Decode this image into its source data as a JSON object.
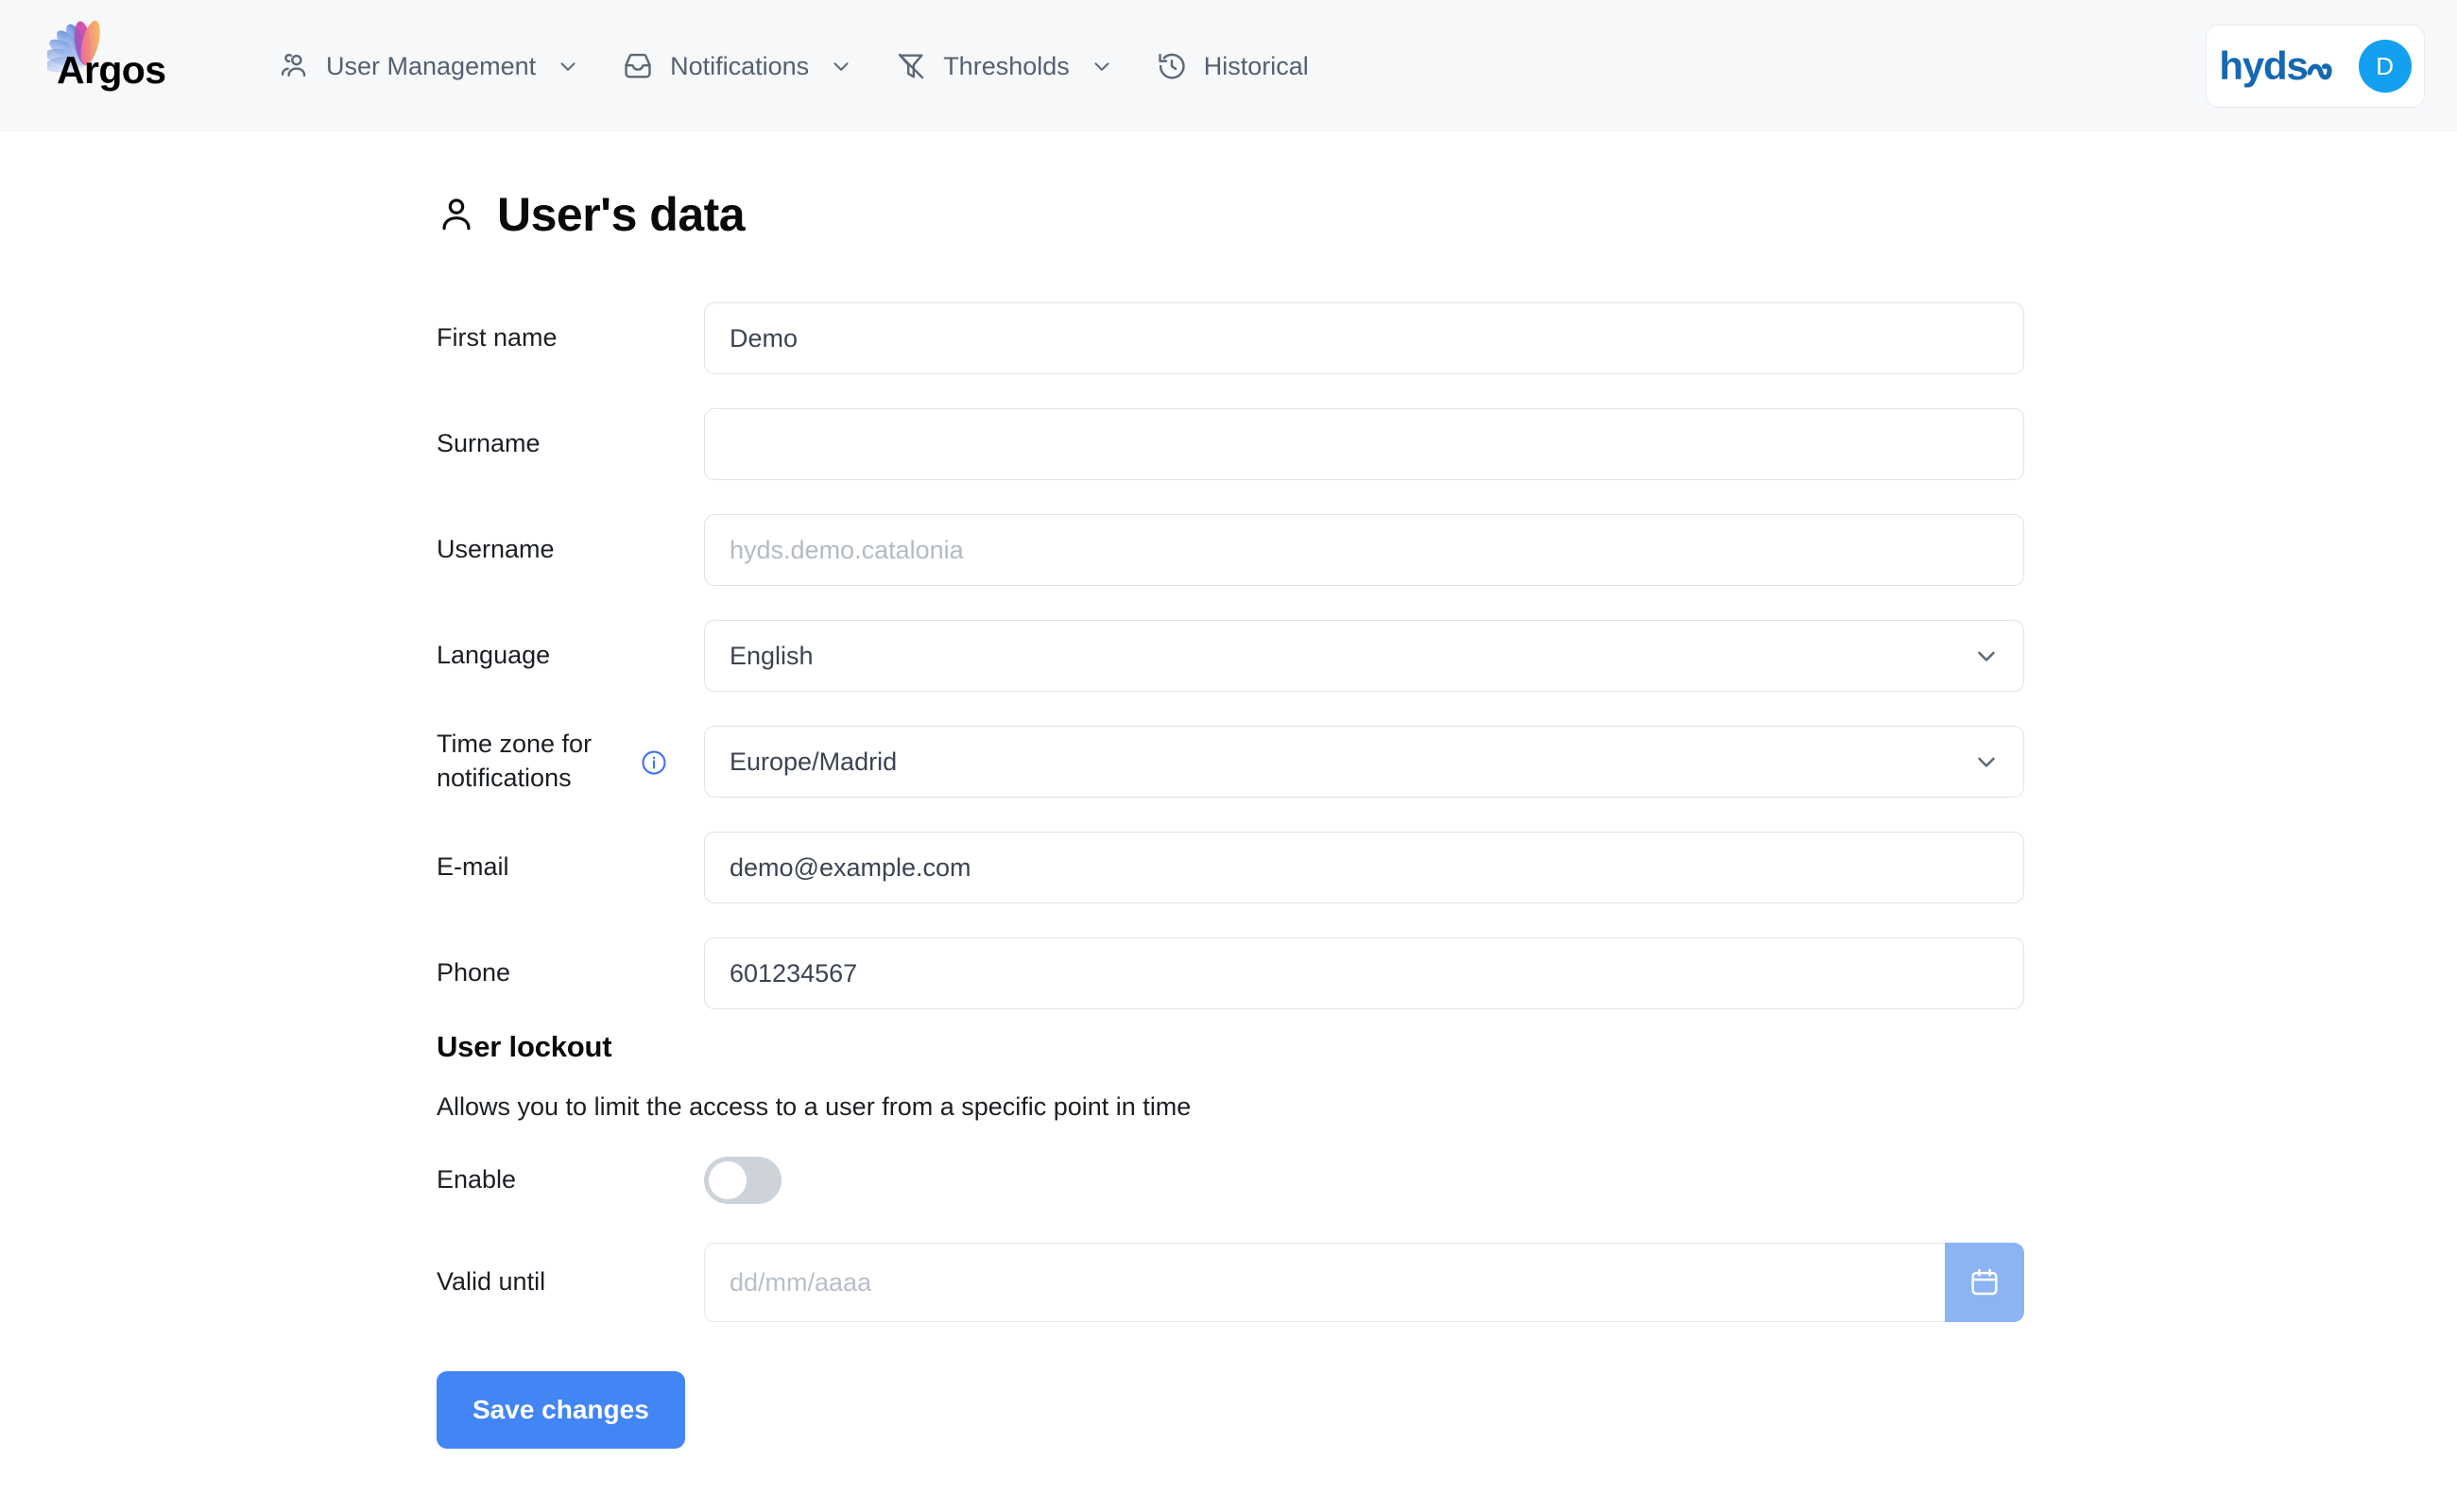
{
  "topnav": {
    "brand_name": "Argos",
    "brand_logo_icon": "argos-flower-logo",
    "items": [
      {
        "label": "User Management",
        "icon": "users-icon",
        "has_caret": true
      },
      {
        "label": "Notifications",
        "icon": "inbox-icon",
        "has_caret": true
      },
      {
        "label": "Thresholds",
        "icon": "filter-off-icon",
        "has_caret": true
      },
      {
        "label": "Historical",
        "icon": "history-clock-icon",
        "has_caret": false
      }
    ],
    "account": {
      "logo_text": "hyds",
      "logo_icon": "hyds-wave-icon",
      "avatar_initial": "D",
      "avatar_color": "#13a0f0",
      "logo_color": "#1668b3"
    }
  },
  "page": {
    "title": "User's data",
    "title_icon": "user-icon"
  },
  "form": {
    "fields": [
      {
        "label": "First name",
        "value": "Demo",
        "placeholder": "",
        "muted": false,
        "type": "text"
      },
      {
        "label": "Surname",
        "value": "",
        "placeholder": "",
        "muted": false,
        "type": "text"
      },
      {
        "label": "Username",
        "value": "hyds.demo.catalonia",
        "placeholder": "hyds.demo.catalonia",
        "muted": true,
        "type": "text"
      },
      {
        "label": "Language",
        "value": "English",
        "placeholder": "",
        "muted": false,
        "type": "select"
      },
      {
        "label": "Time zone for notifications",
        "value": "Europe/Madrid",
        "placeholder": "",
        "muted": false,
        "type": "select",
        "info_icon": "info-circle-icon"
      },
      {
        "label": "E-mail",
        "value": "demo@example.com",
        "placeholder": "",
        "muted": false,
        "type": "text"
      },
      {
        "label": "Phone",
        "value": "601234567",
        "placeholder": "",
        "muted": false,
        "type": "text"
      }
    ]
  },
  "lockout": {
    "title": "User lockout",
    "description": "Allows you to limit the access to a user from a specific point in time",
    "enable_label": "Enable",
    "enable_state": "off",
    "valid_until_label": "Valid until",
    "valid_until_value": "",
    "valid_until_placeholder": "dd/mm/aaaa",
    "calendar_icon": "calendar-icon"
  },
  "actions": {
    "save_label": "Save changes",
    "save_color": "#4285f4"
  }
}
